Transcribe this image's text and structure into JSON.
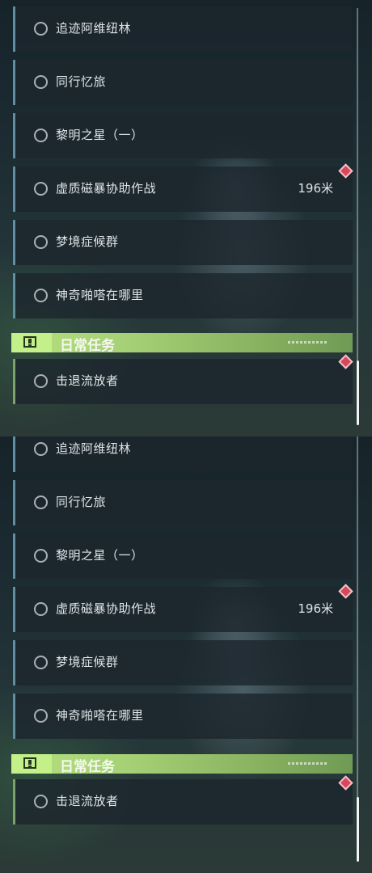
{
  "colors": {
    "daily_header": "#a5d075",
    "quest_accent": "#5f8fa3",
    "daily_accent": "#7aa46a",
    "marker": "#d8475a"
  },
  "quests": [
    {
      "label": "追迹阿维纽林"
    },
    {
      "label": "同行忆旅"
    },
    {
      "label": "黎明之星（一）"
    },
    {
      "label": "虚质磁暴协助作战",
      "distance": "196米"
    },
    {
      "label": "梦境症候群"
    },
    {
      "label": "神奇啪嗒在哪里"
    }
  ],
  "daily": {
    "title": "日常任务",
    "icon": "alert-box-icon",
    "items": [
      {
        "label": "击退流放者"
      }
    ]
  },
  "marker_icon": "diamond-marker-icon"
}
